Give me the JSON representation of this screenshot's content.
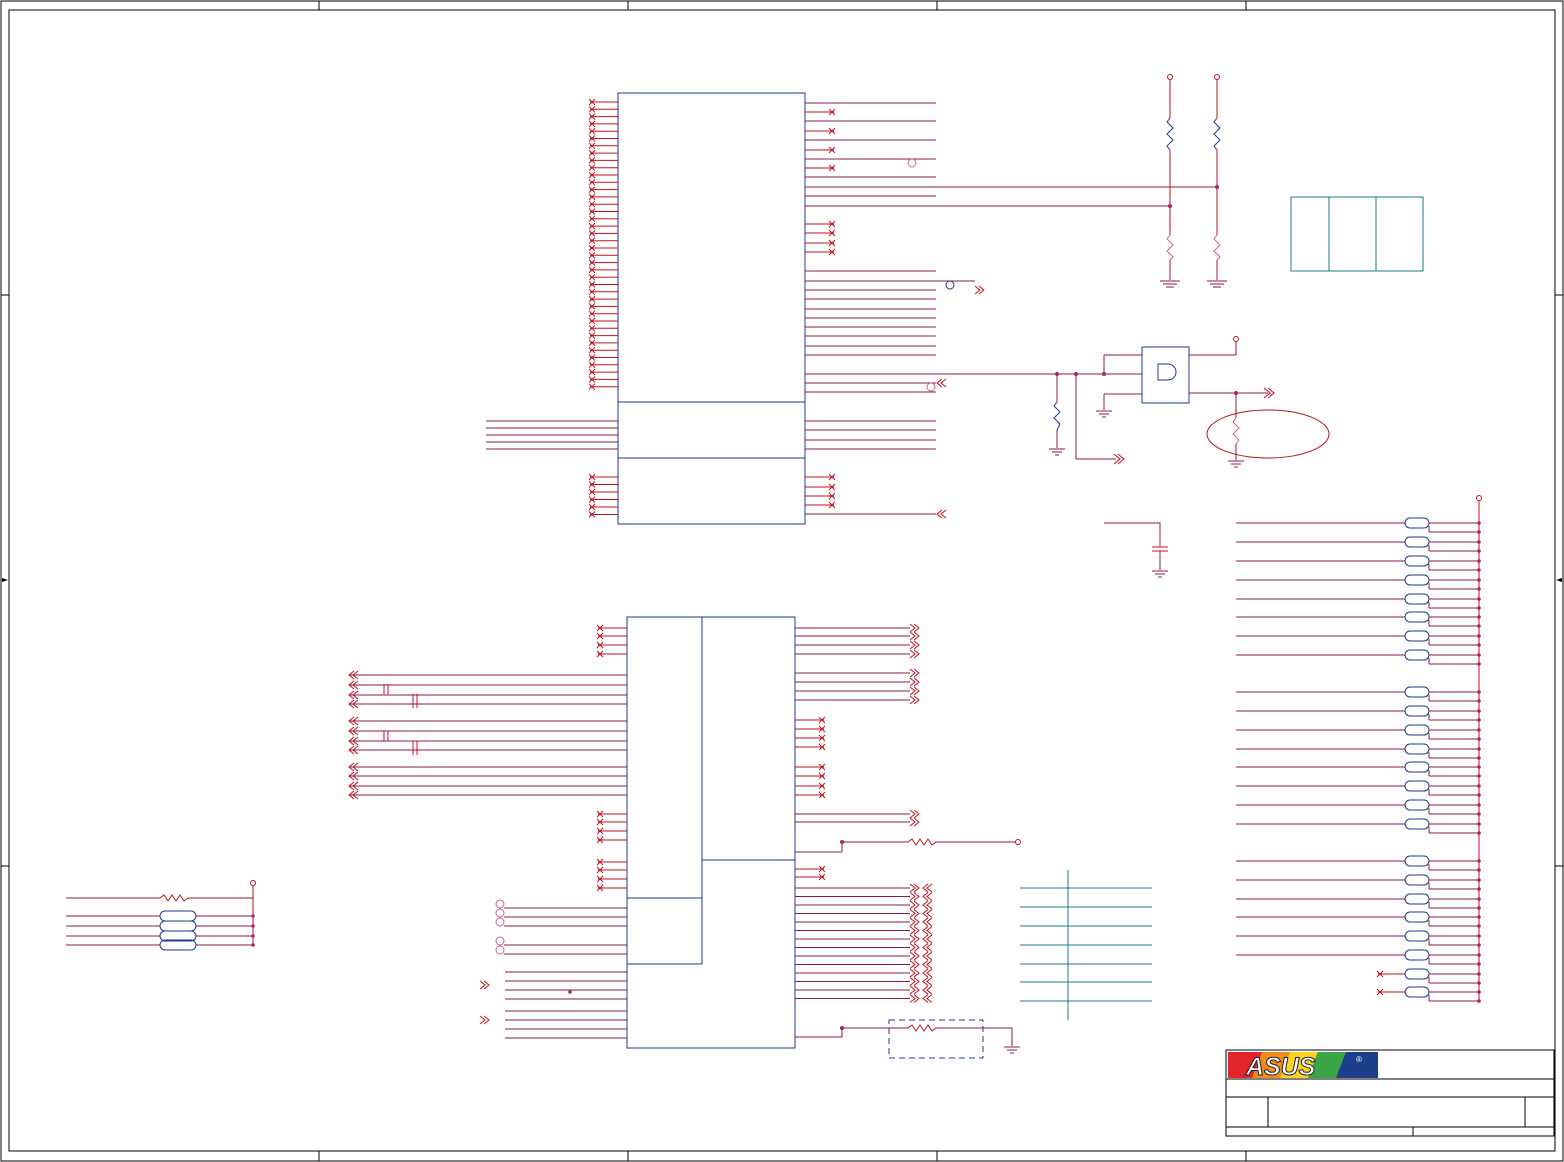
{
  "brand": {
    "logo_text": "ASUS",
    "registered_mark": "®",
    "colors": [
      "#e3242b",
      "#f28c1c",
      "#ffd21f",
      "#3aa648",
      "#2a62b8"
    ]
  },
  "colors": {
    "wire": "#c0101e",
    "net": "#8b1a4a",
    "component": "#1f3a8c",
    "table": "#1c7a80"
  }
}
